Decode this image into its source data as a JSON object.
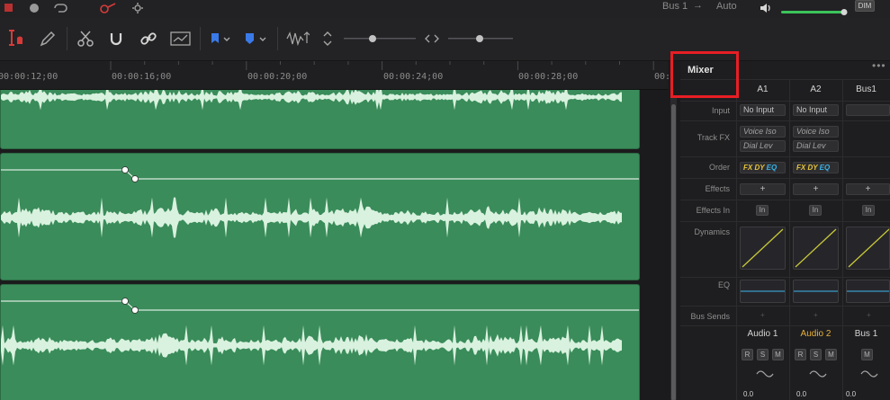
{
  "top_strip": {
    "bus_label": "Bus 1",
    "bus_arrow": "→",
    "bus_mode": "Auto",
    "dim_label": "DIM"
  },
  "timeline": {
    "timecodes": [
      "00:00:12;00",
      "00:00:16;00",
      "00:00:20;00",
      "00:00:24;00",
      "00:00:28;00",
      "00:"
    ]
  },
  "mixer": {
    "tab_label": "Mixer",
    "more_label": "•••",
    "columns": [
      "A1",
      "A2",
      "Bus1"
    ],
    "row_labels": {
      "input": "Input",
      "track_fx": "Track FX",
      "order": "Order",
      "effects": "Effects",
      "effects_in": "Effects In",
      "dynamics": "Dynamics",
      "eq": "EQ",
      "bus_sends": "Bus Sends"
    },
    "input_values": [
      "No Input",
      "No Input"
    ],
    "track_fx": [
      [
        "Voice Iso",
        "Dial Lev"
      ],
      [
        "Voice Iso",
        "Dial Lev"
      ]
    ],
    "order_codes": {
      "fx": "FX",
      "dy": "DY",
      "eq": "EQ"
    },
    "plus": "+",
    "in_label": "In",
    "strip_names": [
      "Audio 1",
      "Audio 2",
      "Bus 1"
    ],
    "rsm": {
      "r": "R",
      "s": "S",
      "m": "M"
    },
    "volumes": [
      "0.0",
      "0.0",
      "0.0"
    ]
  },
  "colors": {
    "clip_green": "#3a8c5a",
    "waveform": "#d9f2df",
    "highlight": "#e81e25",
    "active_strip": "#e8b23a",
    "order_fx": "#e8c53a",
    "order_dy": "#e8c53a",
    "order_eq": "#3ab4e8",
    "volume_green": "#3cc45a",
    "dynamics_line": "#c8c83a",
    "eq_line": "#3a9ac8"
  }
}
